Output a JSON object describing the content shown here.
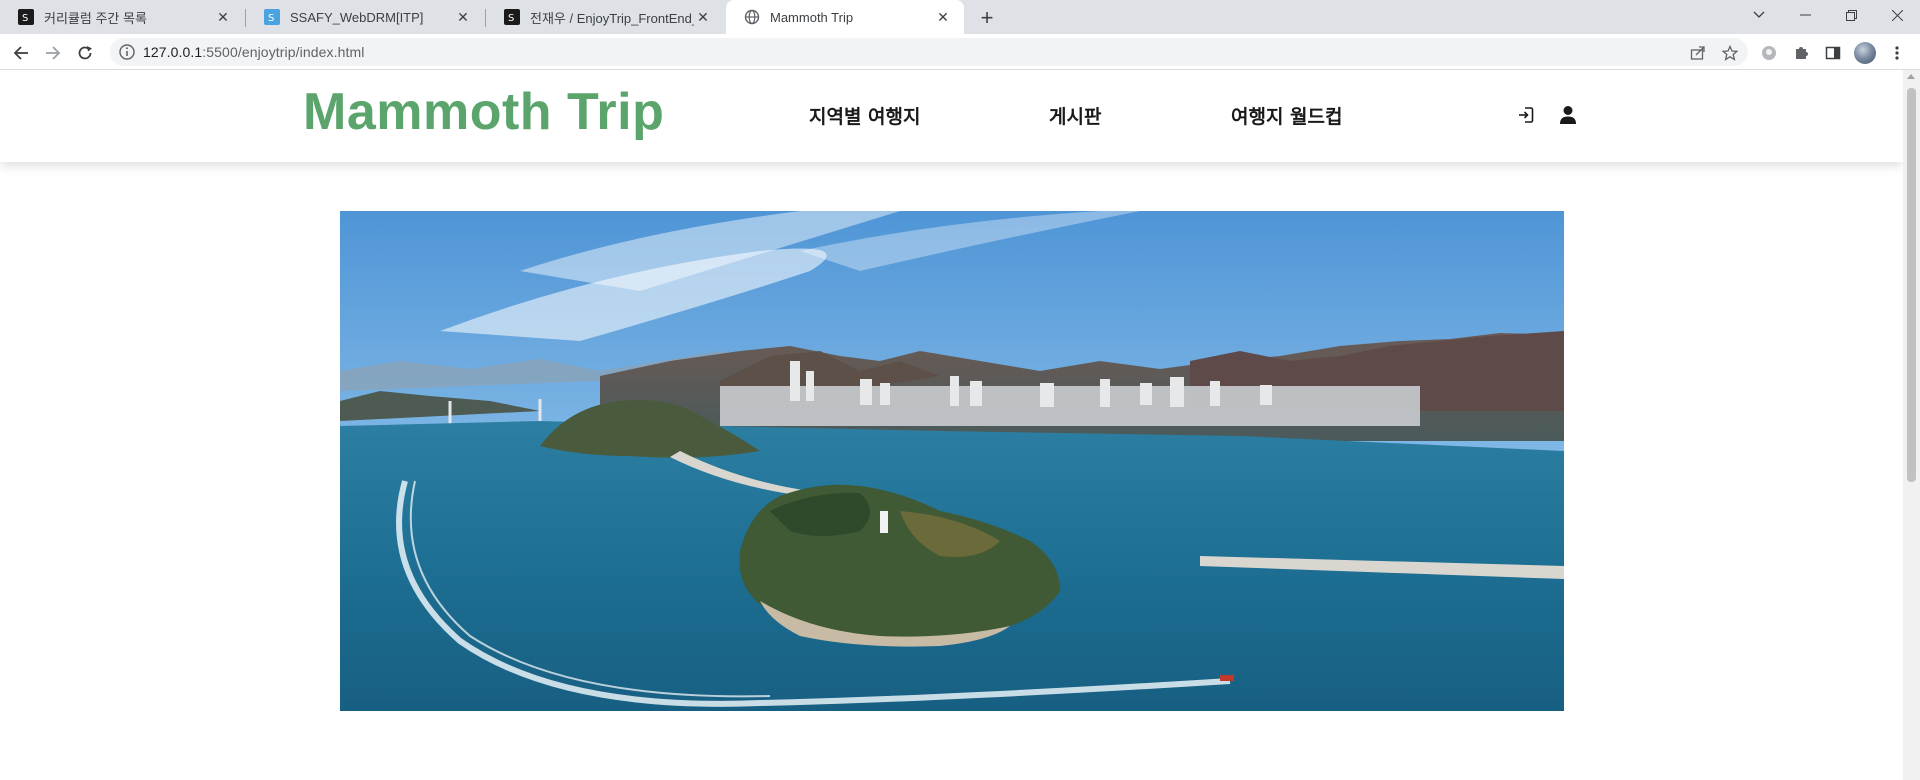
{
  "browser": {
    "tabs": [
      {
        "title": "커리큘럼 주간 목록",
        "favicon": "ssafy-favicon-icon"
      },
      {
        "title": "SSAFY_WebDRM[ITP]",
        "favicon": "webdrm-favicon-icon"
      },
      {
        "title": "전재우 / EnjoyTrip_FrontEnd_서",
        "favicon": "ssafy-favicon-icon"
      },
      {
        "title": "Mammoth Trip",
        "favicon": "globe-icon",
        "active": true
      }
    ],
    "url_host": "127.0.0.1",
    "url_path": ":5500/enjoytrip/index.html"
  },
  "site": {
    "brand": "Mammoth Trip",
    "brand_color": "#5ba56d",
    "nav": {
      "regional": "지역별 여행지",
      "board": "게시판",
      "worldcup": "여행지 월드컵"
    },
    "icons": {
      "login": "login-icon",
      "user": "user-icon"
    }
  },
  "hero": {
    "image": "aerial-harbor-island-photo"
  }
}
